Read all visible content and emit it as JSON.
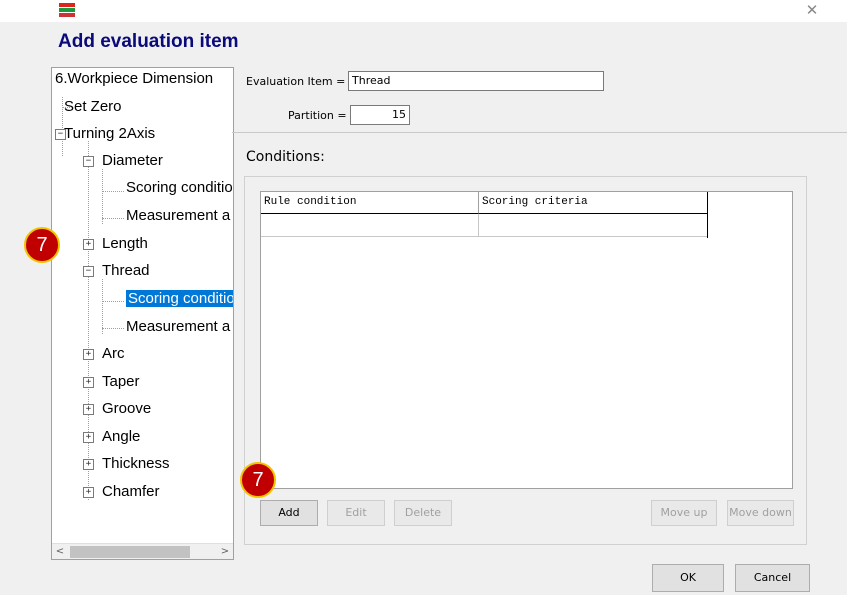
{
  "window": {
    "icon": "chc-app-icon",
    "close_glyph": "✕",
    "dialog_title": "Add evaluation item"
  },
  "tree": {
    "root": "6.Workpiece Dimension",
    "items": [
      {
        "label": "Set Zero"
      },
      {
        "label": "Turning 2Axis",
        "expander": "−"
      },
      {
        "label": "Diameter",
        "expander": "−"
      },
      {
        "label": "Scoring conditio"
      },
      {
        "label": "Measurement a"
      },
      {
        "label": "Length",
        "expander": "+"
      },
      {
        "label": "Thread",
        "expander": "−"
      },
      {
        "label": "Scoring conditio",
        "selected": true
      },
      {
        "label": "Measurement a"
      },
      {
        "label": "Arc",
        "expander": "+"
      },
      {
        "label": "Taper",
        "expander": "+"
      },
      {
        "label": "Groove",
        "expander": "+"
      },
      {
        "label": "Angle",
        "expander": "+"
      },
      {
        "label": "Thickness",
        "expander": "+"
      },
      {
        "label": "Chamfer",
        "expander": "+"
      }
    ],
    "scroll_left": "<",
    "scroll_right": ">"
  },
  "form": {
    "evaluation_item_label": "Evaluation Item =",
    "evaluation_item_value": "Thread",
    "partition_label": "Partition =",
    "partition_value": "15"
  },
  "conditions": {
    "label": "Conditions:",
    "columns": [
      "Rule condition",
      "Scoring criteria"
    ]
  },
  "buttons": {
    "add": "Add",
    "edit": "Edit",
    "delete": "Delete",
    "move_up": "Move up",
    "move_down": "Move down",
    "ok": "OK",
    "cancel": "Cancel"
  },
  "annotations": {
    "badge_tree": "7",
    "badge_add": "7"
  },
  "colors": {
    "title": "#0a0a7a",
    "selection": "#0078d7",
    "badge_fill": "#c00000",
    "badge_ring": "#f2c400"
  }
}
